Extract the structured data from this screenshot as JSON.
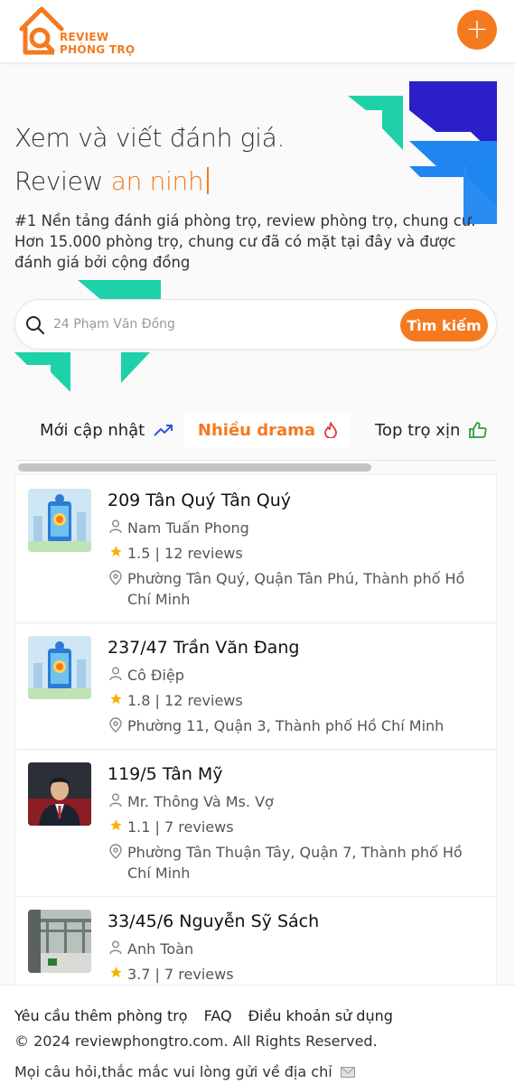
{
  "header": {
    "logo_line1": "REVIEW",
    "logo_line2": "PHÒNG TRỌ",
    "add_button": "+"
  },
  "hero": {
    "title": "Xem và viết đánh giá.",
    "subtitle_prefix": "Review",
    "subtitle_accent": "an ninh",
    "description": "#1 Nền tảng đánh giá phòng trọ, review phòng trọ, chung cư. Hơn 15.000 phòng trọ, chung cư đã có mặt tại đây và được đánh giá bởi cộng đồng"
  },
  "search": {
    "placeholder": "24 Phạm Văn Đồng",
    "button_label": "Tìm kiếm"
  },
  "tabs": [
    {
      "label": "Mới cập nhật",
      "icon": "trending-up-icon",
      "active": false
    },
    {
      "label": "Nhiều drama",
      "icon": "flame-icon",
      "active": true
    },
    {
      "label": "Top trọ xịn",
      "icon": "thumbs-up-icon",
      "active": false
    }
  ],
  "listings": [
    {
      "title": "209 Tân Quý Tân Quý",
      "owner": "Nam Tuấn Phong",
      "rating": "1.5 | 12 reviews",
      "address": "Phường Tân Quý, Quận Tân Phú, Thành phố Hồ Chí Minh",
      "thumb": "map-phone-illustration"
    },
    {
      "title": "237/47 Trần Văn Đang",
      "owner": "Cô Điệp",
      "rating": "1.8 | 12 reviews",
      "address": "Phường 11, Quận 3, Thành phố Hồ Chí Minh",
      "thumb": "map-phone-illustration"
    },
    {
      "title": "119/5 Tân Mỹ",
      "owner": "Mr. Thông Và Ms. Vợ",
      "rating": "1.1 | 7 reviews",
      "address": "Phường Tân Thuận Tây, Quận 7, Thành phố Hồ Chí Minh",
      "thumb": "portrait-photo"
    },
    {
      "title": "33/45/6 Nguyễn Sỹ Sách",
      "owner": "Anh Toàn",
      "rating": "3.7 | 7 reviews",
      "address": "",
      "thumb": "rooftop-photo"
    }
  ],
  "footer": {
    "links": [
      "Yêu cầu thêm phòng trọ",
      "FAQ",
      "Điều khoản sử dụng"
    ],
    "copyright": "© 2024 reviewphongtro.com. All Rights Reserved.",
    "contact": "Mọi câu hỏi,thắc mắc vui lòng gửi về địa chỉ"
  },
  "colors": {
    "accent": "#f47a20",
    "teal": "#1fd1a9",
    "blue_dark": "#2a1fc9",
    "blue_light": "#1f86f0",
    "star": "#f5b301"
  }
}
